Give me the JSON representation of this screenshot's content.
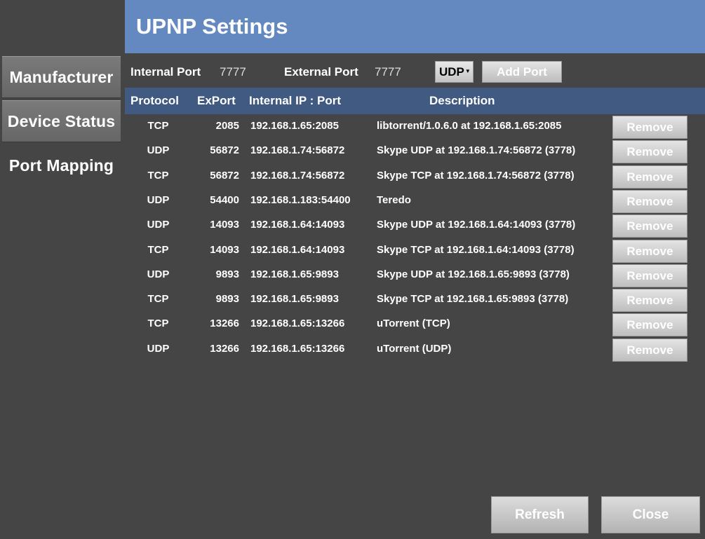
{
  "title": "UPNP Settings",
  "sidebar": {
    "items": [
      {
        "label": "Manufacturer"
      },
      {
        "label": "Device Status"
      },
      {
        "label": "Port Mapping"
      }
    ]
  },
  "form": {
    "internal_port_label": "Internal Port",
    "internal_port_value": "7777",
    "external_port_label": "External Port",
    "external_port_value": "7777",
    "protocol_selected": "UDP",
    "add_port_label": "Add Port"
  },
  "table": {
    "headers": {
      "protocol": "Protocol",
      "export": "ExPort",
      "internal": "Internal IP : Port",
      "description": "Description"
    },
    "remove_label": "Remove",
    "rows": [
      {
        "protocol": "TCP",
        "export": "2085",
        "internal": "192.168.1.65:2085",
        "description": "libtorrent/1.0.6.0 at 192.168.1.65:2085"
      },
      {
        "protocol": "UDP",
        "export": "56872",
        "internal": "192.168.1.74:56872",
        "description": "Skype UDP at 192.168.1.74:56872 (3778)"
      },
      {
        "protocol": "TCP",
        "export": "56872",
        "internal": "192.168.1.74:56872",
        "description": "Skype TCP at 192.168.1.74:56872 (3778)"
      },
      {
        "protocol": "UDP",
        "export": "54400",
        "internal": "192.168.1.183:54400",
        "description": "Teredo"
      },
      {
        "protocol": "UDP",
        "export": "14093",
        "internal": "192.168.1.64:14093",
        "description": "Skype UDP at 192.168.1.64:14093 (3778)"
      },
      {
        "protocol": "TCP",
        "export": "14093",
        "internal": "192.168.1.64:14093",
        "description": "Skype TCP at 192.168.1.64:14093 (3778)"
      },
      {
        "protocol": "UDP",
        "export": "9893",
        "internal": "192.168.1.65:9893",
        "description": "Skype UDP at 192.168.1.65:9893 (3778)"
      },
      {
        "protocol": "TCP",
        "export": "9893",
        "internal": "192.168.1.65:9893",
        "description": "Skype TCP at 192.168.1.65:9893 (3778)"
      },
      {
        "protocol": "TCP",
        "export": "13266",
        "internal": "192.168.1.65:13266",
        "description": "uTorrent (TCP)"
      },
      {
        "protocol": "UDP",
        "export": "13266",
        "internal": "192.168.1.65:13266",
        "description": "uTorrent (UDP)"
      }
    ]
  },
  "footer": {
    "refresh_label": "Refresh",
    "close_label": "Close"
  },
  "icons": {
    "dropdown": "caret-down-icon"
  },
  "colors": {
    "title_bar": "#6389c0",
    "table_header": "#405a82",
    "background": "#454545"
  }
}
